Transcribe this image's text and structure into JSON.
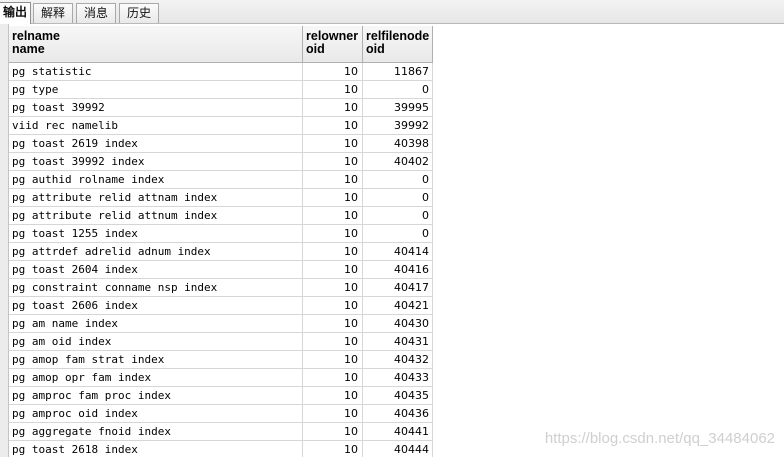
{
  "tabs": [
    {
      "label": "输出",
      "active": true
    },
    {
      "label": "解释",
      "active": false
    },
    {
      "label": "消息",
      "active": false
    },
    {
      "label": "历史",
      "active": false
    }
  ],
  "table": {
    "columns": [
      {
        "name": "relname",
        "type": "name"
      },
      {
        "name": "relowner",
        "type": "oid"
      },
      {
        "name": "relfilenode",
        "type": "oid"
      }
    ],
    "rows": [
      [
        "pg statistic",
        "10",
        "11867"
      ],
      [
        "pg type",
        "10",
        "0"
      ],
      [
        "pg toast 39992",
        "10",
        "39995"
      ],
      [
        "viid rec namelib",
        "10",
        "39992"
      ],
      [
        "pg toast 2619 index",
        "10",
        "40398"
      ],
      [
        "pg toast 39992 index",
        "10",
        "40402"
      ],
      [
        "pg authid rolname index",
        "10",
        "0"
      ],
      [
        "pg attribute relid attnam index",
        "10",
        "0"
      ],
      [
        "pg attribute relid attnum index",
        "10",
        "0"
      ],
      [
        "pg toast 1255 index",
        "10",
        "0"
      ],
      [
        "pg attrdef adrelid adnum index",
        "10",
        "40414"
      ],
      [
        "pg toast 2604 index",
        "10",
        "40416"
      ],
      [
        "pg constraint conname nsp index",
        "10",
        "40417"
      ],
      [
        "pg toast 2606 index",
        "10",
        "40421"
      ],
      [
        "pg am name index",
        "10",
        "40430"
      ],
      [
        "pg am oid index",
        "10",
        "40431"
      ],
      [
        "pg amop fam strat index",
        "10",
        "40432"
      ],
      [
        "pg amop opr fam index",
        "10",
        "40433"
      ],
      [
        "pg amproc fam proc index",
        "10",
        "40435"
      ],
      [
        "pg amproc oid index",
        "10",
        "40436"
      ],
      [
        "pg aggregate fnoid index",
        "10",
        "40441"
      ],
      [
        "pg toast 2618 index",
        "10",
        "40444"
      ]
    ]
  },
  "watermark": "https://blog.csdn.net/qq_34484062"
}
